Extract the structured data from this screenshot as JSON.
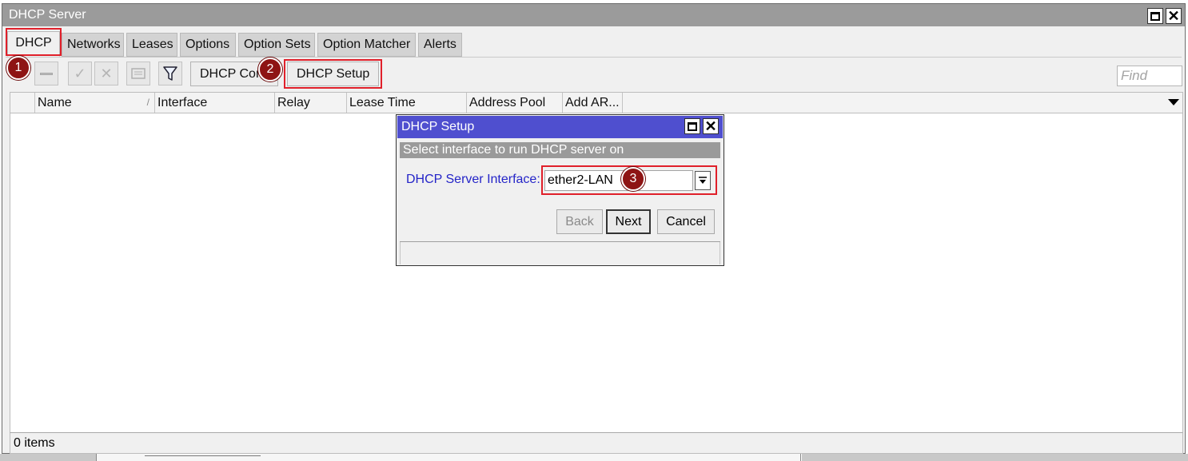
{
  "window": {
    "title": "DHCP Server"
  },
  "tabs": [
    {
      "label": "DHCP"
    },
    {
      "label": "Networks"
    },
    {
      "label": "Leases"
    },
    {
      "label": "Options"
    },
    {
      "label": "Option Sets"
    },
    {
      "label": "Option Matcher"
    },
    {
      "label": "Alerts"
    }
  ],
  "toolbar": {
    "dhcp_config_label": "DHCP Con",
    "dhcp_setup_label": "DHCP Setup",
    "find_placeholder": "Find"
  },
  "table": {
    "columns": [
      "Name",
      "Interface",
      "Relay",
      "Lease Time",
      "Address Pool",
      "Add AR..."
    ],
    "rows": []
  },
  "status": {
    "items": "0 items"
  },
  "dialog": {
    "title": "DHCP Setup",
    "subtitle": "Select interface to run DHCP server on",
    "field_label": "DHCP Server Interface:",
    "field_value": "ether2-LAN",
    "buttons": {
      "back": "Back",
      "next": "Next",
      "cancel": "Cancel"
    }
  },
  "annotations": {
    "badge1": "1",
    "badge2": "2",
    "badge3": "3"
  },
  "colors": {
    "titlebar": "#9b9b9b",
    "dialog_titlebar": "#4f4fcf",
    "highlight_box": "#e0202a",
    "badge": "#8e1414",
    "field_label": "#2424c8"
  },
  "icons": [
    "restore-icon",
    "close-icon",
    "minus-icon",
    "check-icon",
    "cross-icon",
    "comment-icon",
    "filter-icon",
    "dropdown-arrow-icon"
  ]
}
